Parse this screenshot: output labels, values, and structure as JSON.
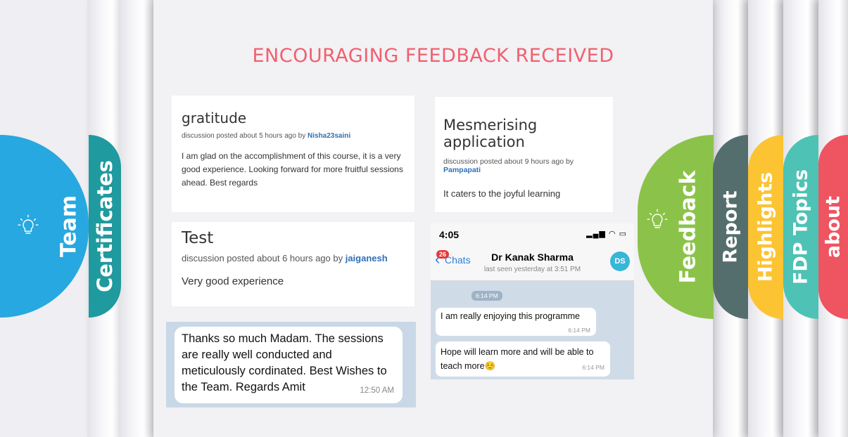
{
  "title": "ENCOURAGING FEEDBACK RECEIVED",
  "left_tabs": [
    {
      "label": "Team",
      "color": "#27a8e0"
    },
    {
      "label": "Certificates",
      "color": "#1f9a9e"
    }
  ],
  "right_tabs": [
    {
      "label": "Feedback",
      "color": "#8bc34a"
    },
    {
      "label": "Report",
      "color": "#546e6e"
    },
    {
      "label": "Highlights",
      "color": "#fcc333"
    },
    {
      "label": "FDP Topics",
      "color": "#4ec2b5"
    },
    {
      "label": "about",
      "color": "#ef5461"
    }
  ],
  "cards": [
    {
      "title": "gratitude",
      "meta_prefix": "discussion posted about 5 hours ago by ",
      "user": "Nisha23saini",
      "body": "I am glad on the accomplishment of this course, it is a very good experience. Looking forward for more fruitful sessions ahead. Best regards"
    },
    {
      "title": "Test",
      "meta_prefix": "discussion posted about 6 hours ago by ",
      "user": "jaiganesh",
      "body": "Very good experience"
    },
    {
      "title": "Mesmerising application",
      "meta_prefix": "discussion posted about 9 hours ago by ",
      "user": "Pampapati",
      "body": "It caters to the joyful learning"
    }
  ],
  "chat_bubble": {
    "text": "Thanks so much Madam. The sessions are really well conducted and meticulously cordinated. Best Wishes to the Team. Regards Amit",
    "time": "12:50 AM"
  },
  "phone": {
    "clock": "4:05",
    "back_label": "Chats",
    "badge": "26",
    "contact_name": "Dr Kanak Sharma",
    "last_seen": "last seen yesterday at 3:51 PM",
    "avatar_initials": "DS",
    "date_chip": "6:14 PM",
    "messages": [
      {
        "text": "I am really enjoying this programme",
        "time": "6:14 PM"
      },
      {
        "text": "Hope will learn more and will be able to teach more☺️",
        "time": "6:14 PM"
      }
    ]
  }
}
